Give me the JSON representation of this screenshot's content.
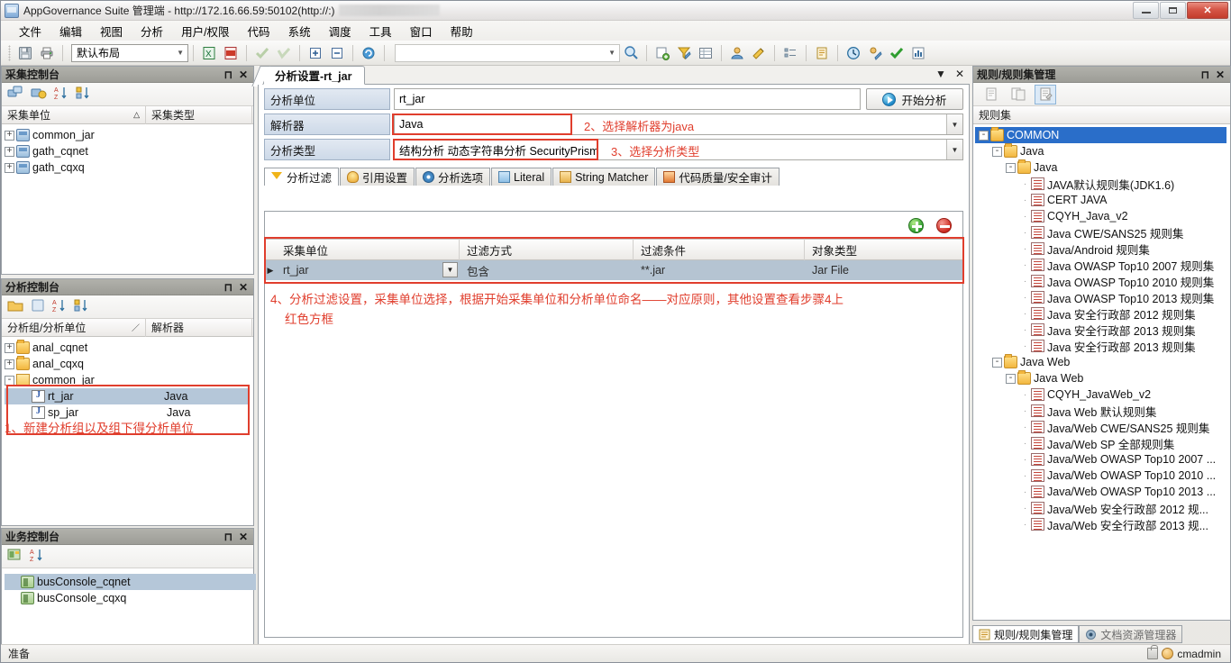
{
  "window": {
    "title": "AppGovernance Suite 管理端 - http://172.16.66.59:50102(http://:)",
    "minimize_label": "",
    "maximize_label": "",
    "close_label": "✕"
  },
  "menubar": {
    "items": [
      {
        "label": "文件"
      },
      {
        "label": "编辑"
      },
      {
        "label": "视图"
      },
      {
        "label": "分析"
      },
      {
        "label": "用户/权限"
      },
      {
        "label": "代码"
      },
      {
        "label": "系统"
      },
      {
        "label": "调度"
      },
      {
        "label": "工具"
      },
      {
        "label": "窗口"
      },
      {
        "label": "帮助"
      }
    ]
  },
  "toolbar": {
    "layout_value": "默认布局",
    "layout_arrow": "▼",
    "second_combo_value": "",
    "second_combo_arrow": "▼",
    "icons": [
      "save-icon",
      "print-icon",
      "excel-export-icon",
      "pdf-export-icon",
      "check-all-icon",
      "uncheck-all-icon",
      "expand-all-icon",
      "collapse-all-icon",
      "refresh-icon",
      "search-icon",
      "new-report-icon",
      "filter-edit-icon",
      "table-settings-icon",
      "user-icon",
      "edit-rule-icon",
      "list-icon",
      "document-icon",
      "schedule-icon",
      "audit-icon",
      "approve-icon",
      "chart-icon"
    ]
  },
  "collect_console": {
    "title": "采集控制台",
    "pin": "⊓",
    "close": "✕",
    "columns": [
      {
        "label": "采集单位",
        "sort": "△"
      },
      {
        "label": "采集类型"
      }
    ],
    "items": [
      {
        "label": "common_jar",
        "expander": "+",
        "icon": "network-unit-icon"
      },
      {
        "label": "gath_cqnet",
        "expander": "+",
        "icon": "network-unit-icon"
      },
      {
        "label": "gath_cqxq",
        "expander": "+",
        "icon": "network-unit-icon"
      }
    ]
  },
  "analysis_console": {
    "title": "分析控制台",
    "pin": "⊓",
    "close": "✕",
    "columns": [
      {
        "label": "分析组/分析单位",
        "sort": "／"
      },
      {
        "label": "解析器"
      }
    ],
    "items": [
      {
        "label": "anal_cqnet",
        "expander": "+",
        "icon": "folder-icon",
        "parser": "",
        "level": 0,
        "selected": false
      },
      {
        "label": "anal_cqxq",
        "expander": "+",
        "icon": "folder-icon",
        "parser": "",
        "level": 0,
        "selected": false
      },
      {
        "label": "common_jar",
        "expander": "-",
        "icon": "folder-icon",
        "parser": "",
        "level": 0,
        "selected": false
      },
      {
        "label": "rt_jar",
        "expander": "",
        "icon": "java-unit-icon",
        "parser": "Java",
        "level": 1,
        "selected": true
      },
      {
        "label": "sp_jar",
        "expander": "",
        "icon": "java-unit-icon",
        "parser": "Java",
        "level": 1,
        "selected": false
      }
    ],
    "annotation": "1、新建分析组以及组下得分析单位"
  },
  "business_console": {
    "title": "业务控制台",
    "pin": "⊓",
    "close": "✕",
    "items": [
      {
        "label": "busConsole_cqnet",
        "icon": "business-icon",
        "selected": true
      },
      {
        "label": "busConsole_cqxq",
        "icon": "business-icon",
        "selected": false
      }
    ]
  },
  "document": {
    "tab_label": "分析设置-rt_jar",
    "menu_arrow": "▼",
    "close": "✕",
    "fields": [
      {
        "label": "分析单位",
        "value": "rt_jar",
        "has_dropdown": false,
        "highlight": false
      },
      {
        "label": "解析器",
        "value": "Java",
        "has_dropdown": true,
        "highlight": true
      },
      {
        "label": "分析类型",
        "value": "结构分析 动态字符串分析 SecurityPrism",
        "has_dropdown": true,
        "highlight": true
      }
    ],
    "start_button": "开始分析",
    "annotation_parser": "2、选择解析器为java",
    "annotation_type": "3、选择分析类型",
    "inner_tabs": [
      {
        "label": "分析过滤",
        "icon": "funnel-icon",
        "active": true
      },
      {
        "label": "引用设置",
        "icon": "bulb-icon",
        "active": false
      },
      {
        "label": "分析选项",
        "icon": "gear-icon",
        "active": false
      },
      {
        "label": "Literal",
        "icon": "literal-icon",
        "active": false
      },
      {
        "label": "String Matcher",
        "icon": "string-matcher-icon",
        "active": false
      },
      {
        "label": "代码质量/安全审计",
        "icon": "flag-icon",
        "active": false
      }
    ],
    "grid": {
      "add_label": "",
      "delete_label": "",
      "columns": [
        "采集单位",
        "过滤方式",
        "过滤条件",
        "对象类型"
      ],
      "rows": [
        {
          "采集单位": "rt_jar",
          "过滤方式": "包含",
          "过滤条件": "**.jar",
          "对象类型": "Jar File"
        }
      ]
    },
    "annotation_filter_line1": "4、分析过滤设置，采集单位选择，根据开始采集单位和分析单位命名——对应原则，其他设置查看步骤4上",
    "annotation_filter_line2": "红色方框"
  },
  "rules_panel": {
    "title": "规则/规则集管理",
    "pin": "⊓",
    "close": "✕",
    "toolbar_icons": [
      "new-rule-icon",
      "copy-rule-icon",
      "edit-rule-icon"
    ],
    "column_header": "规则集",
    "tree": [
      {
        "label": "COMMON",
        "level": 0,
        "expander": "-",
        "icon": "folder-icon",
        "selected": true
      },
      {
        "label": "Java",
        "level": 1,
        "expander": "-",
        "icon": "folder-icon",
        "selected": false
      },
      {
        "label": "Java",
        "level": 2,
        "expander": "-",
        "icon": "folder-icon",
        "selected": false
      },
      {
        "label": "JAVA默认规则集(JDK1.6)",
        "level": 3,
        "expander": "",
        "icon": "ruleset-icon",
        "selected": false
      },
      {
        "label": "CERT JAVA",
        "level": 3,
        "expander": "",
        "icon": "ruleset-icon",
        "selected": false
      },
      {
        "label": "CQYH_Java_v2",
        "level": 3,
        "expander": "",
        "icon": "ruleset-icon",
        "selected": false
      },
      {
        "label": "Java CWE/SANS25 规则集",
        "level": 3,
        "expander": "",
        "icon": "ruleset-icon",
        "selected": false
      },
      {
        "label": "Java/Android 规则集",
        "level": 3,
        "expander": "",
        "icon": "ruleset-icon",
        "selected": false
      },
      {
        "label": "Java OWASP Top10 2007 规则集",
        "level": 3,
        "expander": "",
        "icon": "ruleset-icon",
        "selected": false
      },
      {
        "label": "Java OWASP Top10 2010 规则集",
        "level": 3,
        "expander": "",
        "icon": "ruleset-icon",
        "selected": false
      },
      {
        "label": "Java OWASP Top10 2013 规则集",
        "level": 3,
        "expander": "",
        "icon": "ruleset-icon",
        "selected": false
      },
      {
        "label": "Java 安全行政部 2012 规则集",
        "level": 3,
        "expander": "",
        "icon": "ruleset-icon",
        "selected": false
      },
      {
        "label": "Java 安全行政部 2013 规则集",
        "level": 3,
        "expander": "",
        "icon": "ruleset-icon",
        "selected": false
      },
      {
        "label": "Java 安全行政部 2013 规则集",
        "level": 3,
        "expander": "",
        "icon": "ruleset-icon",
        "selected": false
      },
      {
        "label": "Java Web",
        "level": 1,
        "expander": "-",
        "icon": "folder-icon",
        "selected": false
      },
      {
        "label": "Java Web",
        "level": 2,
        "expander": "-",
        "icon": "folder-icon",
        "selected": false
      },
      {
        "label": "CQYH_JavaWeb_v2",
        "level": 3,
        "expander": "",
        "icon": "ruleset-icon",
        "selected": false
      },
      {
        "label": "Java Web 默认规则集",
        "level": 3,
        "expander": "",
        "icon": "ruleset-icon",
        "selected": false
      },
      {
        "label": "Java/Web CWE/SANS25 规则集",
        "level": 3,
        "expander": "",
        "icon": "ruleset-icon",
        "selected": false
      },
      {
        "label": "Java/Web SP 全部规则集",
        "level": 3,
        "expander": "",
        "icon": "ruleset-icon",
        "selected": false
      },
      {
        "label": "Java/Web OWASP Top10 2007 ...",
        "level": 3,
        "expander": "",
        "icon": "ruleset-icon",
        "selected": false
      },
      {
        "label": "Java/Web OWASP Top10 2010 ...",
        "level": 3,
        "expander": "",
        "icon": "ruleset-icon",
        "selected": false
      },
      {
        "label": "Java/Web OWASP Top10 2013 ...",
        "level": 3,
        "expander": "",
        "icon": "ruleset-icon",
        "selected": false
      },
      {
        "label": "Java/Web 安全行政部 2012 规...",
        "level": 3,
        "expander": "",
        "icon": "ruleset-icon",
        "selected": false
      },
      {
        "label": "Java/Web 安全行政部 2013 规...",
        "level": 3,
        "expander": "",
        "icon": "ruleset-icon",
        "selected": false
      }
    ]
  },
  "bottom_tabs": [
    {
      "label": "规则/规则集管理",
      "icon": "rules-icon",
      "active": true
    },
    {
      "label": "文档资源管理器",
      "icon": "document-explorer-icon",
      "active": false
    }
  ],
  "statusbar": {
    "status": "准备",
    "user": "cmadmin",
    "lock_icon": "lock-icon",
    "user_icon": "user-icon"
  },
  "colors": {
    "accent_blue": "#2a6ec9",
    "annotation_red": "#e03e2d",
    "selection_gray_blue": "#b5c7d9",
    "panel_header": "#9d9d97"
  }
}
